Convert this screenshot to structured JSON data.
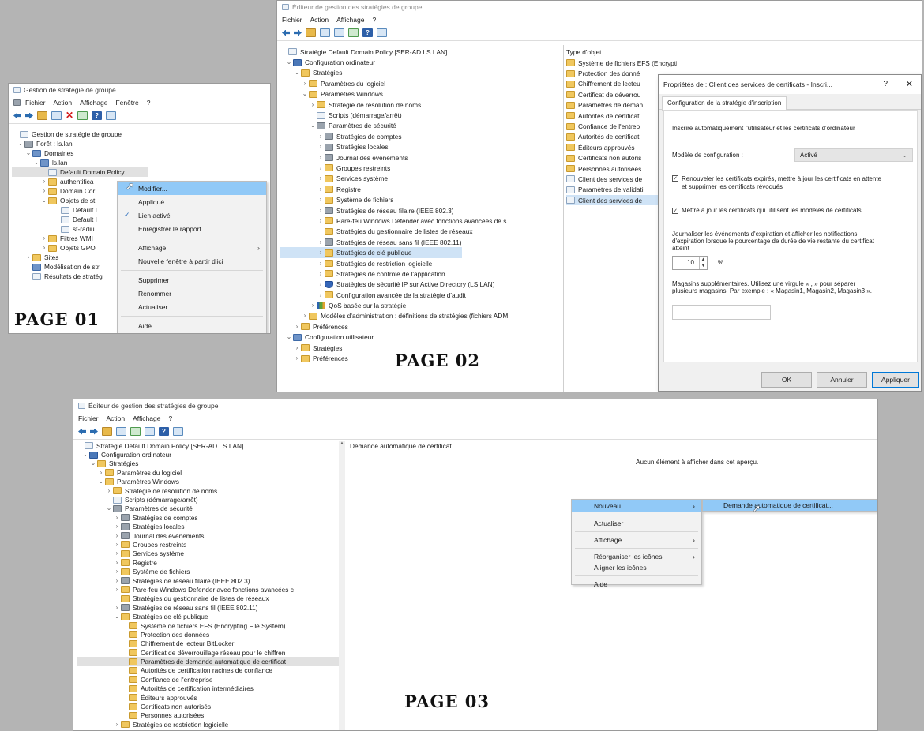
{
  "page1": {
    "title": "Gestion de stratégie de groupe",
    "menu": [
      "Fichier",
      "Action",
      "Affichage",
      "Fenêtre",
      "?"
    ],
    "tree": [
      {
        "label": "Gestion de stratégie de groupe"
      },
      {
        "label": "Forêt : ls.lan"
      },
      {
        "label": "Domaines"
      },
      {
        "label": "ls.lan"
      },
      {
        "label": "Default Domain Policy"
      },
      {
        "label": "authentifica"
      },
      {
        "label": "Domain Cor"
      },
      {
        "label": "Objets de st"
      },
      {
        "label": "Default I"
      },
      {
        "label": "Default I"
      },
      {
        "label": "st-radiu"
      },
      {
        "label": "Filtres WMI"
      },
      {
        "label": "Objets GPO"
      },
      {
        "label": "Sites"
      },
      {
        "label": "Modélisation de str"
      },
      {
        "label": "Résultats de stratég"
      }
    ],
    "context_menu": [
      "Modifier...",
      "Appliqué",
      "Lien activé",
      "Enregistrer le rapport...",
      "Affichage",
      "Nouvelle fenêtre à partir d'ici",
      "Supprimer",
      "Renommer",
      "Actualiser",
      "Aide"
    ],
    "page_label": "PAGE 01"
  },
  "page2": {
    "title": "Éditeur de gestion des stratégies de groupe",
    "menu": [
      "Fichier",
      "Action",
      "Affichage",
      "?"
    ],
    "tree": [
      "Stratégie Default Domain Policy [SER-AD.LS.LAN]",
      "Configuration ordinateur",
      "Stratégies",
      "Paramètres du logiciel",
      "Paramètres Windows",
      "Stratégie de résolution de noms",
      "Scripts (démarrage/arrêt)",
      "Paramètres de sécurité",
      "Stratégies de comptes",
      "Stratégies locales",
      "Journal des événements",
      "Groupes restreints",
      "Services système",
      "Registre",
      "Système de fichiers",
      "Stratégies de réseau filaire (IEEE 802.3)",
      "Pare-feu Windows Defender avec fonctions avancées de s",
      "Stratégies du gestionnaire de listes de réseaux",
      "Stratégies de réseau sans fil (IEEE 802.11)",
      "Stratégies de clé publique",
      "Stratégies de restriction logicielle",
      "Stratégies de contrôle de l'application",
      "Stratégies de sécurité IP sur Active Directory (LS.LAN)",
      "Configuration avancée de la stratégie d'audit",
      "QoS basée sur la stratégie",
      "Modèles d'administration : définitions de stratégies (fichiers ADM",
      "Préférences",
      "Configuration utilisateur",
      "Stratégies",
      "Préférences"
    ],
    "list_header": "Type d'objet",
    "list": [
      "Système de fichiers EFS (Encrypting File System)",
      "Protection des donné",
      "Chiffrement de lecteu",
      "Certificat de déverrou",
      "Paramètres de deman",
      "Autorités de certificati",
      "Confiance de l'entrep",
      "Autorités de certificati",
      "Éditeurs approuvés",
      "Certificats non autoris",
      "Personnes autorisées",
      "Client des services de",
      "Paramètres de validati",
      "Client des services de"
    ],
    "dialog": {
      "title": "Propriétés de : Client des services de certificats - Inscri...",
      "help": "?",
      "close": "✕",
      "tab": "Configuration de la stratégie d'inscription",
      "intro": "Inscrire automatiquement l'utilisateur et les certificats d'ordinateur",
      "model_label": "Modèle de configuration :",
      "model_value": "Activé",
      "renew_line1": "Renouveler les certificats expirés, mettre à jour les certificats en attente",
      "renew_line2": "et supprimer les certificats révoqués",
      "update_label": "Mettre à jour les certificats qui utilisent les modèles de certificats",
      "log_line1": "Journaliser les événements d'expiration et afficher les notifications",
      "log_line2": "d'expiration lorsque le pourcentage de durée de vie restante du certificat",
      "log_line3": "atteint",
      "percent_value": "10",
      "percent_unit": "%",
      "stores_line1": "Magasins supplémentaires. Utilisez une virgule « , » pour séparer",
      "stores_line2": "plusieurs magasins. Par exemple : « Magasin1, Magasin2, Magasin3 ».",
      "stores_value": "",
      "ok": "OK",
      "cancel": "Annuler",
      "apply": "Appliquer"
    },
    "page_label": "PAGE 02"
  },
  "page3": {
    "title": "Éditeur de gestion des stratégies de groupe",
    "menu": [
      "Fichier",
      "Action",
      "Affichage",
      "?"
    ],
    "tree": [
      "Stratégie Default Domain Policy [SER-AD.LS.LAN]",
      "Configuration ordinateur",
      "Stratégies",
      "Paramètres du logiciel",
      "Paramètres Windows",
      "Stratégie de résolution de noms",
      "Scripts (démarrage/arrêt)",
      "Paramètres de sécurité",
      "Stratégies de comptes",
      "Stratégies locales",
      "Journal des événements",
      "Groupes restreints",
      "Services système",
      "Registre",
      "Système de fichiers",
      "Stratégies de réseau filaire (IEEE 802.3)",
      "Pare-feu Windows Defender avec fonctions avancées c",
      "Stratégies du gestionnaire de listes de réseaux",
      "Stratégies de réseau sans fil (IEEE 802.11)",
      "Stratégies de clé publique",
      "Système de fichiers EFS (Encrypting File System)",
      "Protection des données",
      "Chiffrement de lecteur BitLocker",
      "Certificat de déverrouillage réseau pour le chiffren",
      "Paramètres de demande automatique de certificat",
      "Autorités de certification racines de confiance",
      "Confiance de l'entreprise",
      "Autorités de certification intermédiaires",
      "Éditeurs approuvés",
      "Certificats non autorisés",
      "Personnes autorisées",
      "Stratégies de restriction logicielle"
    ],
    "right_header": "Demande automatique de certificat",
    "empty_text": "Aucun élément à afficher dans cet aperçu.",
    "context_menu": [
      "Nouveau",
      "Actualiser",
      "Affichage",
      "Réorganiser les icônes",
      "Aligner les icônes",
      "Aide"
    ],
    "submenu": [
      "Demande automatique de certificat..."
    ],
    "page_label": "PAGE 03"
  }
}
